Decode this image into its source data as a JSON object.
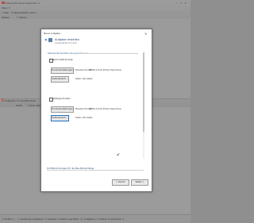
{
  "app": {
    "title": "Automatic Excel Generator 1",
    "menu": "Menu ▾",
    "toolbar": [
      "+ Neu",
      "✎ Bearbeiten",
      "✕ Lösch…"
    ],
    "header": [
      "Status",
      "☐ Name"
    ],
    "lower_toolbar": "Aufgaben im Ausführende",
    "lower_header": [
      "Profil",
      "☐ Prof. Ablauf",
      "Zeit",
      "Sta. Zeit",
      "Status"
    ],
    "status_items": [
      "☐ Profile: 1",
      "☐ Laufende Aufgaben: 0 Geplant: 0 Zeit…",
      "☐ Log Filter: 1",
      "☐ Aufgaben: 0 Status: 0 Gelöscht: 0"
    ]
  },
  "dialog": {
    "title": "Neue Aufgabe",
    "close": "✕",
    "back": "◀",
    "heading": "Aufgabe erstellen",
    "subheading": "Ausgewählte Druckern",
    "section_title": "Standardschnelldruckung ansteuern",
    "option1": {
      "label": "Nach Inhalt drucken",
      "printer_button": "Druckereinstellungen…",
      "printer_label": "Standard Drucker:",
      "printer_value": "HP PCL-6 Auto Printer Class Driver",
      "page_button": "Seitenbereich…",
      "page_label": "Seiten:",
      "page_value": "Alle Seiten"
    },
    "option2": {
      "label": "Anhänge drucken",
      "printer_button": "Druckereinstellungen…",
      "printer_label": "Standard Drucker:",
      "printer_value": "HP PCL-6 Auto Printer Class Driver",
      "page_button": "Seitenbereich…",
      "page_label": "Seiten:",
      "page_value": "Alle Seiten"
    },
    "order_label": "Schriftanordnungen für die Neu-Text-Anhänge",
    "back_button": "< Zurück",
    "next_button": "Weiter >"
  },
  "colors": {
    "accent": "#1e70c8",
    "heading": "#1e3f6e",
    "overlay": "#9a9a9a"
  }
}
